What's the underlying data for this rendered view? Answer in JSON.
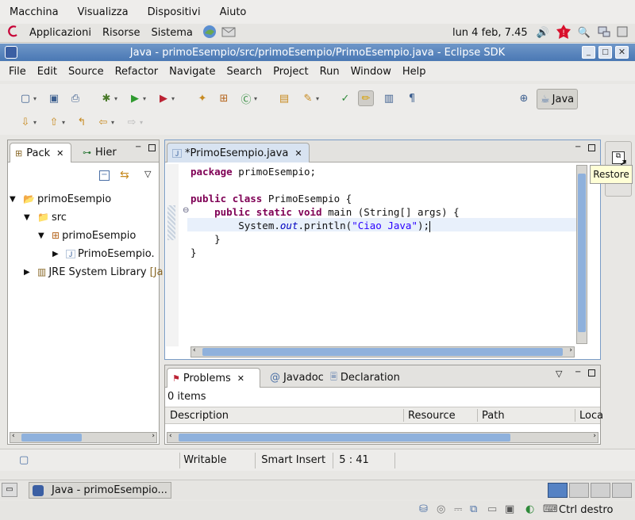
{
  "vm_menu": {
    "items": [
      "Macchina",
      "Visualizza",
      "Dispositivi",
      "Aiuto"
    ]
  },
  "gnome_panel": {
    "apps": "Applicazioni",
    "places": "Risorse",
    "system": "Sistema",
    "clock": "lun  4 feb, 7.45"
  },
  "window": {
    "title": "Java - primoEsempio/src/primoEsempio/PrimoEsempio.java - Eclipse SDK"
  },
  "menubar": {
    "items": [
      "File",
      "Edit",
      "Source",
      "Refactor",
      "Navigate",
      "Search",
      "Project",
      "Run",
      "Window",
      "Help"
    ]
  },
  "perspective": {
    "label": "Java"
  },
  "left_view": {
    "tab_package": "Pack",
    "tab_hierarchy": "Hier",
    "tree": {
      "project": "primoEsempio",
      "src": "src",
      "package": "primoEsempio",
      "file": "PrimoEsempio.",
      "jre": "JRE System Library",
      "jre_suffix": "[Ja"
    }
  },
  "editor": {
    "tab_label": "*PrimoEsempio.java",
    "tooltip": "Restore",
    "lines": {
      "l1_kw": "package",
      "l1_rest": " primoEsempio;",
      "l3_kw1": "public",
      "l3_kw2": "class",
      "l3_rest": " PrimoEsempio {",
      "l4_indent": "    ",
      "l4_kw1": "public",
      "l4_kw2": "static",
      "l4_kw3": "void",
      "l4_rest": " main (String[] args) {",
      "l5_a": "        System.",
      "l5_field": "out",
      "l5_b": ".println(",
      "l5_str": "\"Ciao Java\"",
      "l5_c": ");",
      "l6": "    }",
      "l7": "}"
    }
  },
  "bottom_view": {
    "tab_problems": "Problems",
    "tab_javadoc": "Javadoc",
    "tab_declaration": "Declaration",
    "count": "0 items",
    "columns": [
      "Description",
      "Resource",
      "Path",
      "Loca"
    ]
  },
  "status": {
    "writable": "Writable",
    "insert_mode": "Smart Insert",
    "position": "5 : 41"
  },
  "taskbar": {
    "task_label": "Java - primoEsempio..."
  },
  "bottom_panel": {
    "host_key": "Ctrl destro"
  }
}
